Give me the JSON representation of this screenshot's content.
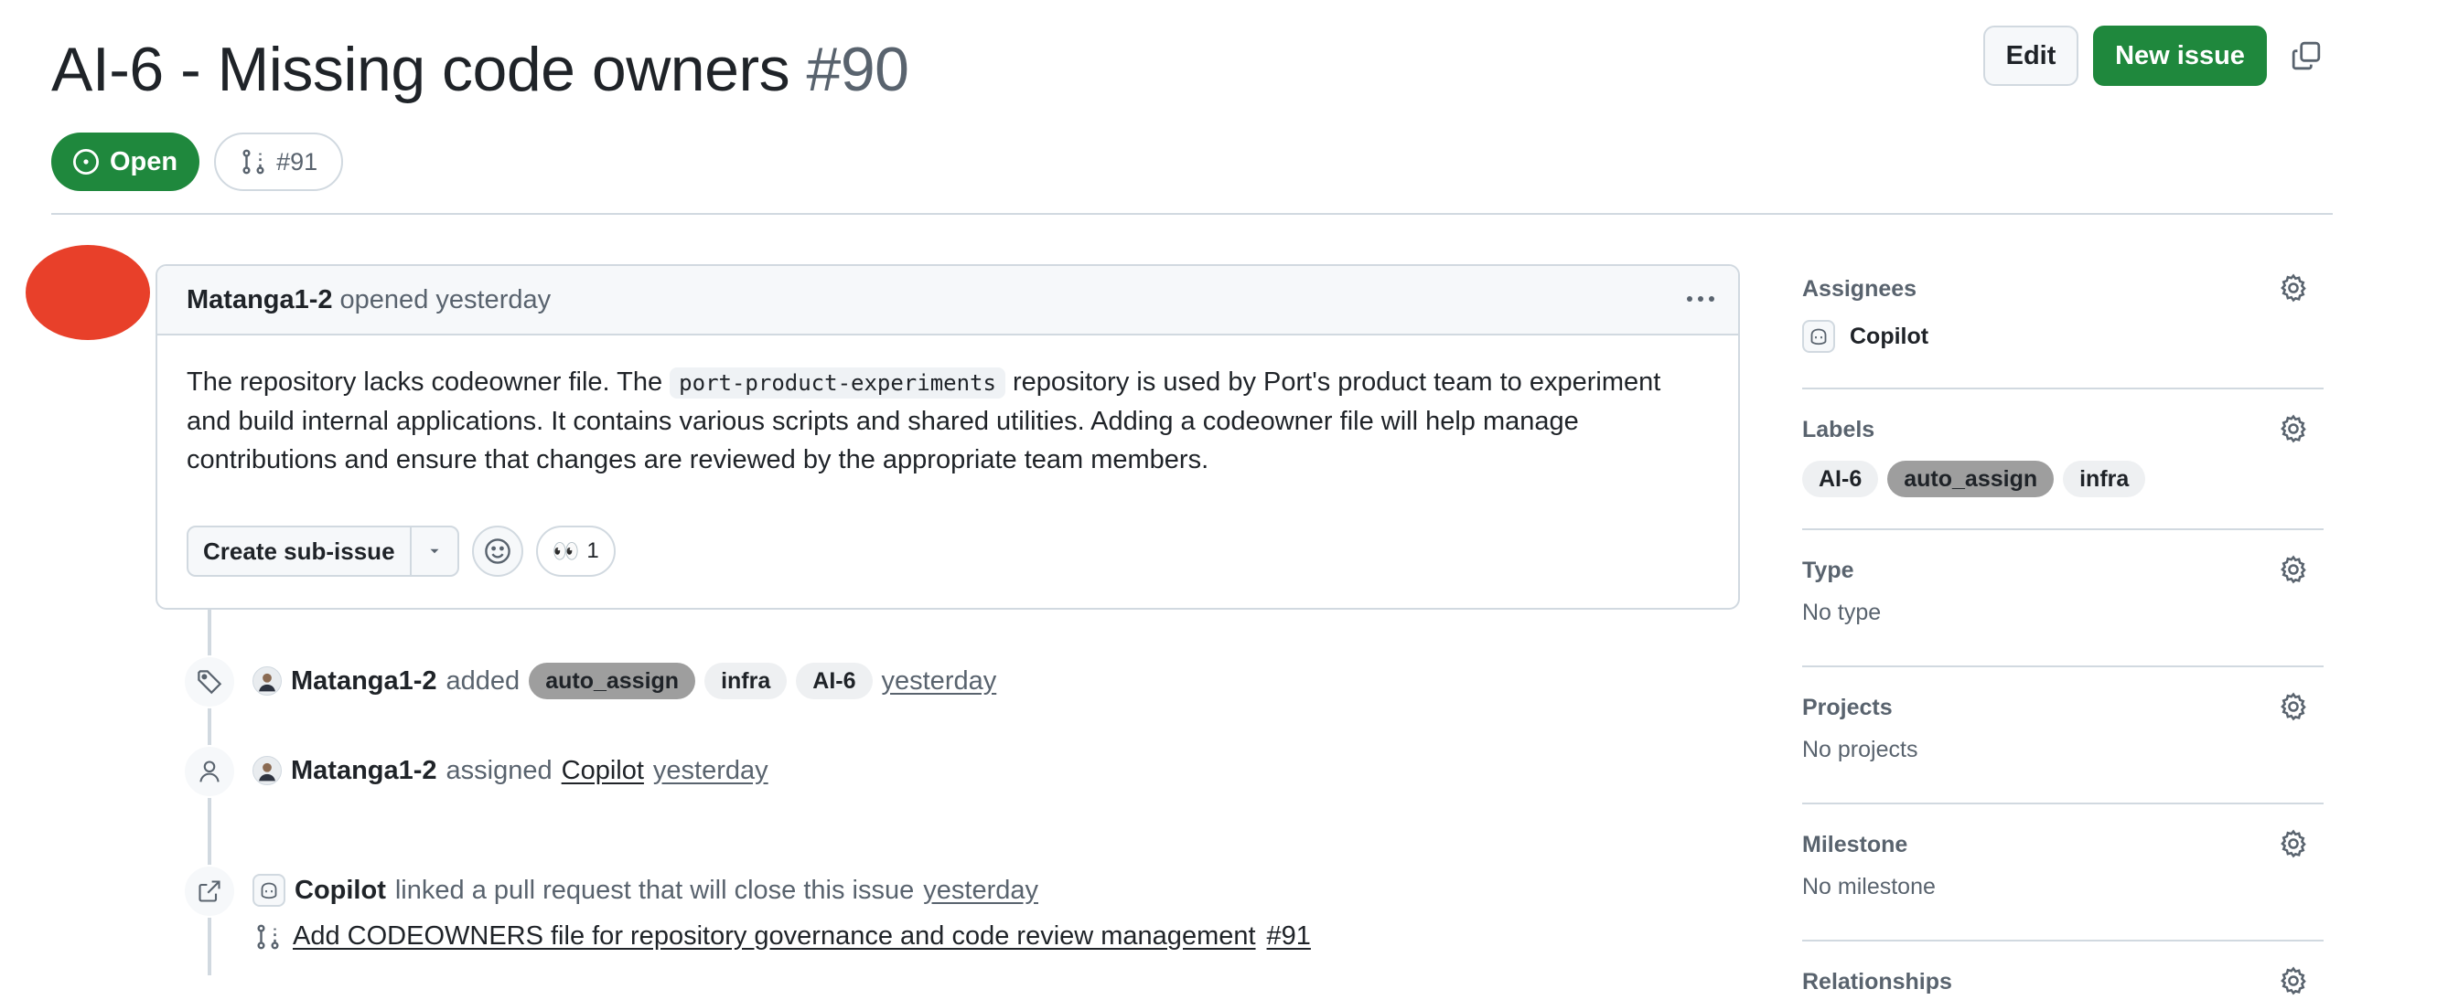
{
  "issue": {
    "title": "AI-6 - Missing code owners",
    "number": "#90",
    "state": "Open",
    "linked_pr": "#91"
  },
  "header_actions": {
    "edit_label": "Edit",
    "new_issue_label": "New issue",
    "copy_icon": "copy-icon"
  },
  "comment": {
    "author": "Matanga1-2",
    "action": "opened yesterday",
    "body_before": "The repository lacks codeowner file. The ",
    "body_code": "port-product-experiments",
    "body_after_line1": " repository is used by Port's product team to experiment",
    "body_line2": "and build internal applications. It contains various scripts and shared utilities. Adding a codeowner file will help manage",
    "body_line3": "contributions and ensure that changes are reviewed by the appropriate team members.",
    "create_sub_issue_label": "Create sub-issue",
    "reaction_emoji": "👀",
    "reaction_count": "1"
  },
  "timeline": {
    "labels_event": {
      "actor": "Matanga1-2",
      "verb": "added",
      "labels": [
        "auto_assign",
        "infra",
        "AI-6"
      ],
      "time": "yesterday"
    },
    "assign_event": {
      "actor": "Matanga1-2",
      "verb": "assigned",
      "assignee": "Copilot",
      "time": "yesterday"
    },
    "link_event": {
      "actor": "Copilot",
      "text": "linked a pull request that will close this issue",
      "time": "yesterday",
      "pr_title": "Add CODEOWNERS file for repository governance and code review management",
      "pr_number": "#91"
    }
  },
  "sidebar": {
    "assignees": {
      "title": "Assignees",
      "value": "Copilot"
    },
    "labels": {
      "title": "Labels",
      "items": [
        "AI-6",
        "auto_assign",
        "infra"
      ]
    },
    "type": {
      "title": "Type",
      "value": "No type"
    },
    "projects": {
      "title": "Projects",
      "value": "No projects"
    },
    "milestone": {
      "title": "Milestone",
      "value": "No milestone"
    },
    "relationships": {
      "title": "Relationships"
    }
  },
  "colors": {
    "open_green": "#1f883d",
    "border": "#d1d9e0",
    "muted_text": "#59636e",
    "avatar_red": "#e8402a"
  }
}
